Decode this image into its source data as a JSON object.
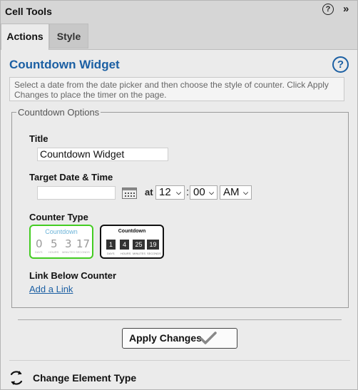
{
  "panel": {
    "title": "Cell Tools",
    "help_icon": "?",
    "collapse_icon": "»"
  },
  "tabs": [
    {
      "label": "Actions",
      "active": true
    },
    {
      "label": "Style",
      "active": false
    }
  ],
  "section": {
    "heading": "Countdown Widget",
    "help_icon": "?",
    "description": "Select a date from the date picker and then choose the style of counter. Click Apply Changes to place the timer on the page."
  },
  "options": {
    "legend": "Countdown Options",
    "title_label": "Title",
    "title_value": "Countdown Widget",
    "target_label": "Target Date & Time",
    "date_value": "",
    "at_label": "at",
    "hour": "12",
    "minute": "00",
    "ampm": "AM",
    "colon": ":",
    "counter_type_label": "Counter Type",
    "counter1": {
      "title": "Countdown",
      "digits": [
        "0",
        "5",
        "3",
        "17"
      ],
      "captions": [
        "DAYS",
        "HOURS",
        "MINUTES",
        "SECONDS"
      ],
      "selected": true
    },
    "counter2": {
      "title": "Countdown",
      "digits": [
        "1",
        "4",
        "25",
        "19"
      ],
      "captions": [
        "DAYS",
        "HOURS",
        "MINUTES",
        "SECONDS"
      ],
      "selected": false
    },
    "link_label": "Link Below Counter",
    "add_link": "Add a Link"
  },
  "apply_label": "Apply Changes",
  "change_type_label": "Change Element Type",
  "colors": {
    "accent": "#1b5fa3",
    "selected_border": "#44cc22"
  }
}
